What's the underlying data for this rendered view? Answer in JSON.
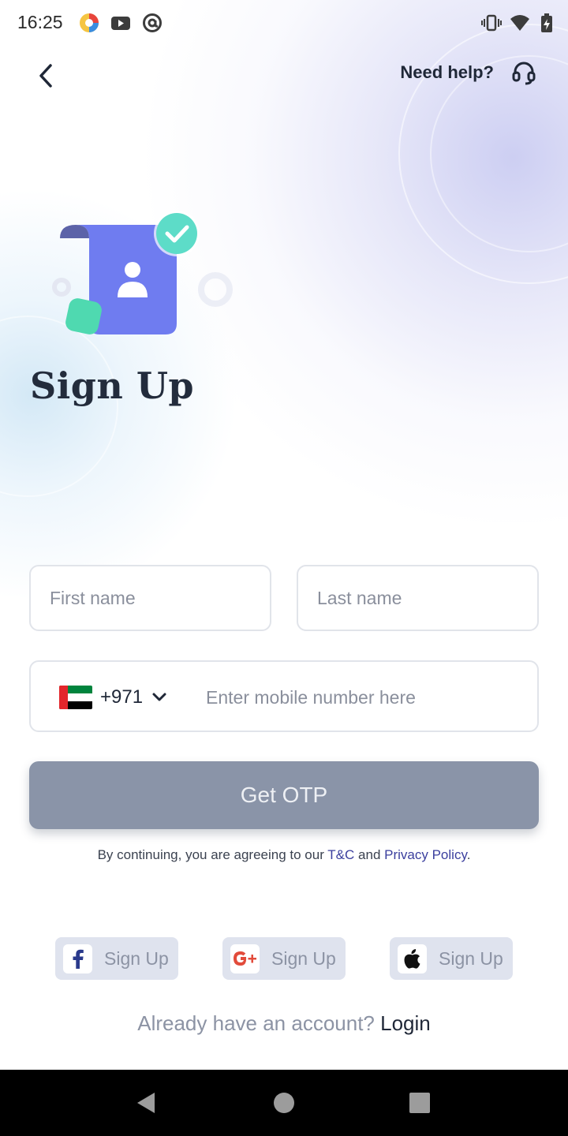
{
  "status_bar": {
    "time": "16:25",
    "icons": [
      "browser-app-icon",
      "youtube-icon",
      "at-sign-icon",
      "vibrate-icon",
      "wifi-icon",
      "battery-charging-icon"
    ]
  },
  "header": {
    "back_icon": "chevron-left-icon",
    "help_label": "Need help?",
    "help_icon": "headset-icon"
  },
  "hero": {
    "title": "Sign Up",
    "illustration": "contact-card-with-check-icon"
  },
  "form": {
    "first_name_placeholder": "First name",
    "last_name_placeholder": "Last name",
    "country_flag": "uae-flag-icon",
    "country_code": "+971",
    "mobile_placeholder": "Enter mobile number here",
    "otp_button": "Get OTP"
  },
  "terms": {
    "prefix": "By continuing, you are agreeing to our",
    "tc_link": "T&C",
    "and": "and",
    "privacy_link": "Privacy Policy",
    "suffix": "."
  },
  "social": [
    {
      "provider_icon": "facebook-icon",
      "label": "Sign Up"
    },
    {
      "provider_icon": "google-plus-icon",
      "label": "Sign Up"
    },
    {
      "provider_icon": "apple-icon",
      "label": "Sign Up"
    }
  ],
  "footer": {
    "prompt": "Already have an account?",
    "login_link": "Login"
  },
  "colors": {
    "title": "#232c3c",
    "otp_button_bg": "#8a94a8",
    "link": "#3b3f9e",
    "social_bg": "#dfe3ee",
    "illustration_card": "#6f7cf0",
    "illustration_check": "#5ddcc8"
  }
}
